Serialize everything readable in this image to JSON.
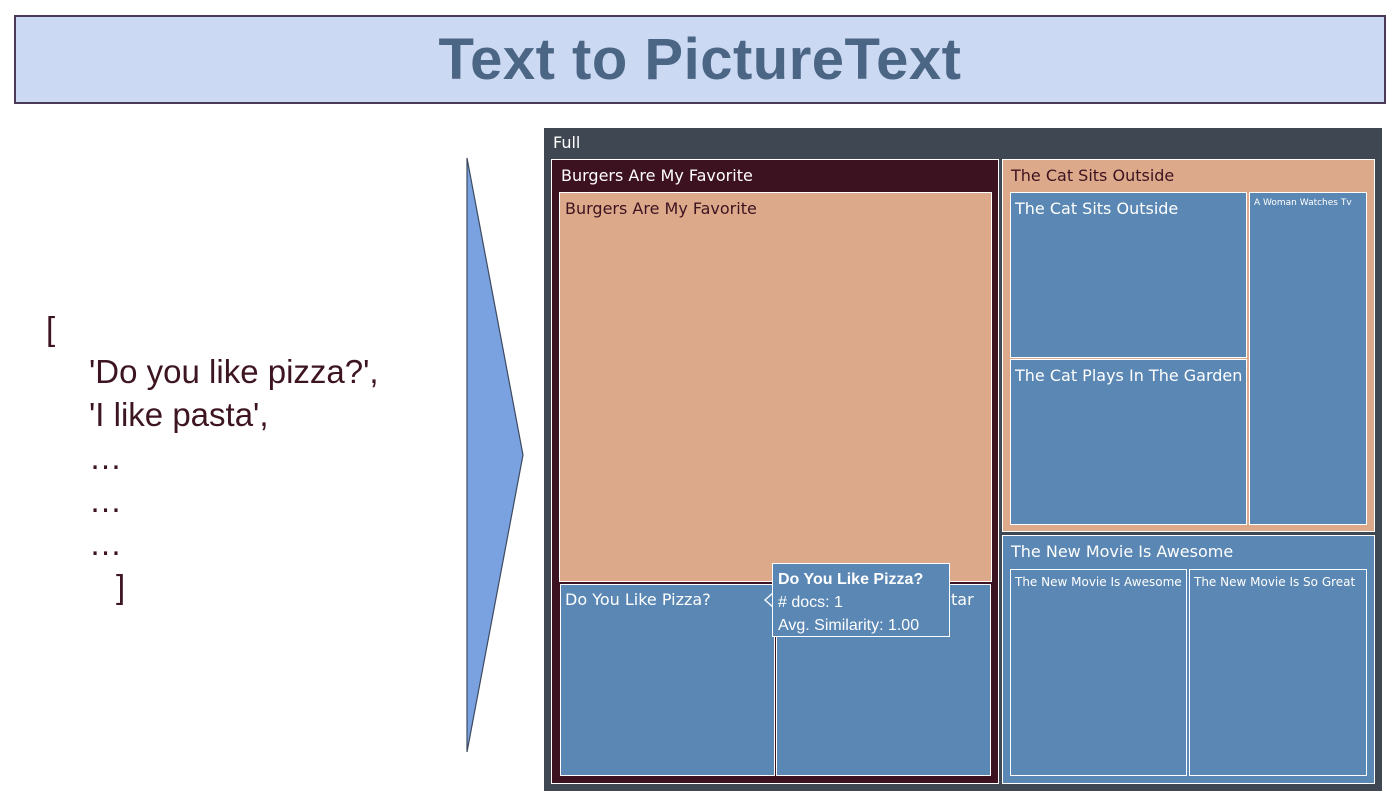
{
  "banner": {
    "title": "Text to PictureText"
  },
  "input_list": {
    "open_bracket": "[",
    "items": [
      "'Do you like pizza?',",
      "'I like pasta',",
      "…",
      "…",
      "…"
    ],
    "close_bracket": "]"
  },
  "treemap": {
    "root_label": "Full",
    "groups": {
      "burgers": {
        "label": "Burgers Are My Favorite",
        "children": [
          "Burgers Are My Favorite",
          "Do You Like Pizza?",
          "tar"
        ]
      },
      "cat": {
        "label": "The Cat Sits Outside",
        "children": [
          "The Cat Sits Outside",
          "The Cat Plays In The Garden",
          "A Woman Watches Tv"
        ]
      },
      "movie": {
        "label": "The New Movie Is Awesome",
        "children": [
          "The New Movie Is Awesome",
          "The New Movie Is So Great"
        ]
      }
    },
    "tooltip": {
      "title": "Do You Like Pizza?",
      "docs": "# docs: 1",
      "similarity": "Avg. Similarity: 1.00"
    }
  },
  "colors": {
    "banner_bg": "#ccd9f2",
    "banner_text": "#4b6585",
    "arrow": "#7aa2e0",
    "root_bg": "#3f4752",
    "burgers_bg": "#3d1220",
    "salmon": "#dcaa8a",
    "blue": "#5a87b3"
  }
}
